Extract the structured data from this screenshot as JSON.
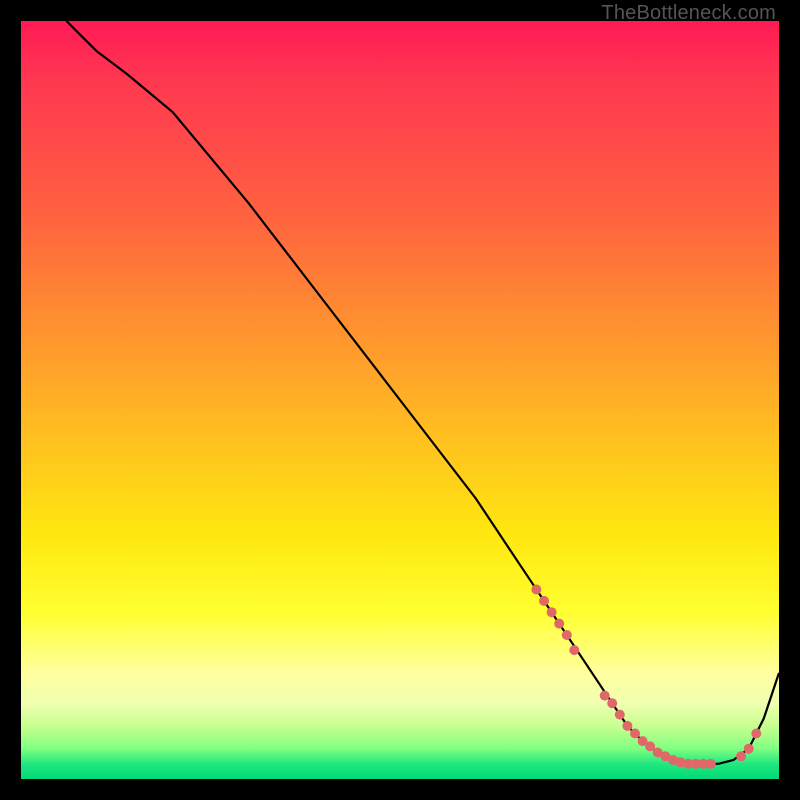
{
  "watermark": "TheBottleneck.com",
  "chart_data": {
    "type": "line",
    "title": "",
    "xlabel": "",
    "ylabel": "",
    "xlim": [
      0,
      100
    ],
    "ylim": [
      0,
      100
    ],
    "grid": false,
    "legend": false,
    "series": [
      {
        "name": "bottleneck-curve",
        "color": "#000000",
        "x": [
          6,
          8,
          10,
          14,
          20,
          30,
          40,
          50,
          60,
          66,
          70,
          74,
          78,
          80,
          82,
          84,
          86,
          88,
          90,
          92,
          94,
          96,
          98,
          100
        ],
        "y": [
          100,
          98,
          96,
          93,
          88,
          76,
          63,
          50,
          37,
          28,
          22,
          16,
          10,
          7,
          5,
          3.5,
          2.5,
          2,
          2,
          2,
          2.5,
          4,
          8,
          14
        ]
      }
    ],
    "markers": [
      {
        "name": "highlight-dots",
        "color": "#e06868",
        "radius": 5,
        "x": [
          68,
          69,
          70,
          71,
          72,
          73,
          77,
          78,
          79,
          80,
          81,
          82,
          83,
          84,
          85,
          86,
          87,
          88,
          89,
          90,
          91,
          95,
          96,
          97
        ],
        "y": [
          25,
          23.5,
          22,
          20.5,
          19,
          17,
          11,
          10,
          8.5,
          7,
          6,
          5,
          4.3,
          3.5,
          3,
          2.5,
          2.2,
          2,
          2,
          2,
          2,
          3,
          4,
          6
        ]
      }
    ]
  }
}
